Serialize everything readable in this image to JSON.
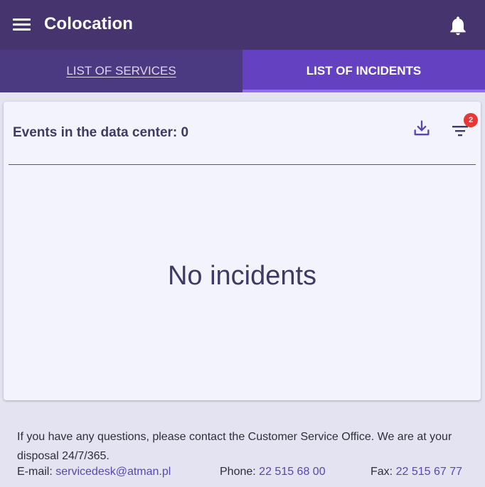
{
  "header": {
    "title": "Colocation",
    "menu_icon": "menu-icon",
    "notifications_icon": "bell-icon"
  },
  "tabs": [
    {
      "label": "LIST OF SERVICES",
      "active": false
    },
    {
      "label": "LIST OF INCIDENTS",
      "active": true
    }
  ],
  "card": {
    "title": "Events in the data center: 0",
    "download_icon": "download-icon",
    "filter_icon": "filter-icon",
    "filter_badge": "2",
    "empty_message": "No incidents"
  },
  "footer": {
    "note": "If you have any questions, please contact the Customer Service Office. We are at your disposal 24/7/365.",
    "email_label": "E-mail:",
    "email": "servicedesk@atman.pl",
    "phone_label": "Phone:",
    "phone": "22 515 68 00",
    "fax_label": "Fax:",
    "fax": "22 515 67 77"
  },
  "colors": {
    "app_bar": "#46346f",
    "tab_bar": "#4b3a81",
    "tab_active": "#6441c0",
    "badge": "#e53935",
    "link": "#5a46b3"
  }
}
